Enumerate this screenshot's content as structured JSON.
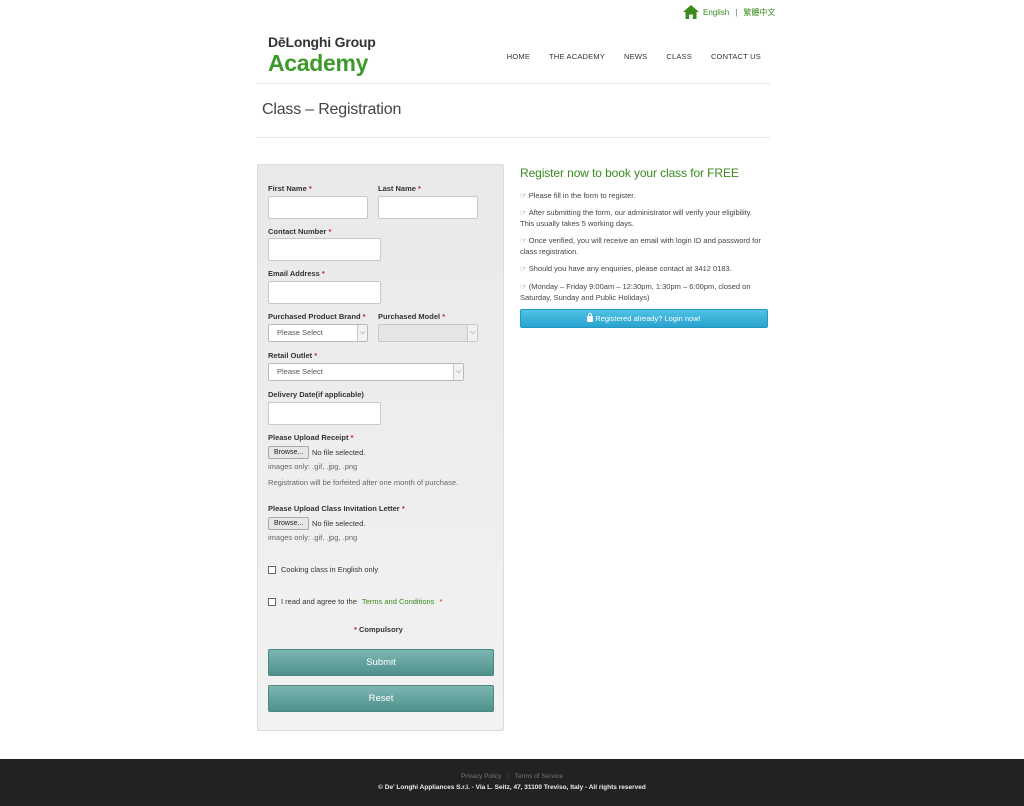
{
  "lang": {
    "english": "English",
    "chinese": "繁體中文",
    "separator": "|"
  },
  "logo": {
    "line1": "DēLonghi Group",
    "line2": "Academy"
  },
  "nav": {
    "home": "HOME",
    "academy": "THE ACADEMY",
    "news": "NEWS",
    "class": "CLASS",
    "contact": "CONTACT US"
  },
  "page": {
    "title": "Class – Registration"
  },
  "form": {
    "first_name": "First Name",
    "last_name": "Last Name",
    "contact_number": "Contact Number",
    "email": "Email Address",
    "brand": "Purchased Product Brand",
    "model": "Purchased Model",
    "brand_select": "Please Select",
    "retail_outlet": "Retail Outlet",
    "outlet_select": "Please Select",
    "delivery_date": "Delivery Date(if applicable)",
    "upload_receipt": "Please Upload Receipt",
    "browse": "Browse...",
    "no_file": "No file selected.",
    "images_only": "images only: .gif, .jpg, .png",
    "forfeit_note": "Registration will be forfeited after one month of purchase.",
    "upload_invitation": "Please Upload Class Invitation Letter",
    "cooking_english": "Cooking class in English only",
    "agree_prefix": "I read and agree to the",
    "terms": "Terms and Conditions",
    "asterisk": "*",
    "compulsory": "Compulsory",
    "submit": "Submit",
    "reset": "Reset",
    "arrow": "⌵"
  },
  "info": {
    "heading": "Register now to book your class for FREE",
    "pointer": "☞",
    "p1": "Please fill in the form to register.",
    "p2": "After submitting the form, our administrator will verify your eligibility. This usually takes 5 working days.",
    "p3": "Once verified, you will receive an email with login ID and password for class registration.",
    "p4": "Should you have any enquiries, please contact at 3412 0183.",
    "p5": "(Monday – Friday 9:00am – 12:30pm, 1:30pm – 6:00pm, closed on Saturday, Sunday and Public Holidays)",
    "login_button": "Registered already? Login now!"
  },
  "footer": {
    "privacy": "Privacy Policy",
    "terms": "Terms of Service",
    "separator": "|",
    "copyright": "© De'  Longhi Appliances S.r.l. - Via L. Seitz, 47, 31100 Treviso, Italy - All rights reserved"
  },
  "colors": {
    "brand_green": "#3d9a2b",
    "button_teal": "#5f9f9a",
    "login_blue": "#33aedb",
    "footer_bg": "#222222"
  },
  "icons": {
    "home": "home-icon",
    "lock": "lock-icon",
    "pointer": "pointing-hand-icon",
    "chevron": "chevron-down-icon"
  }
}
